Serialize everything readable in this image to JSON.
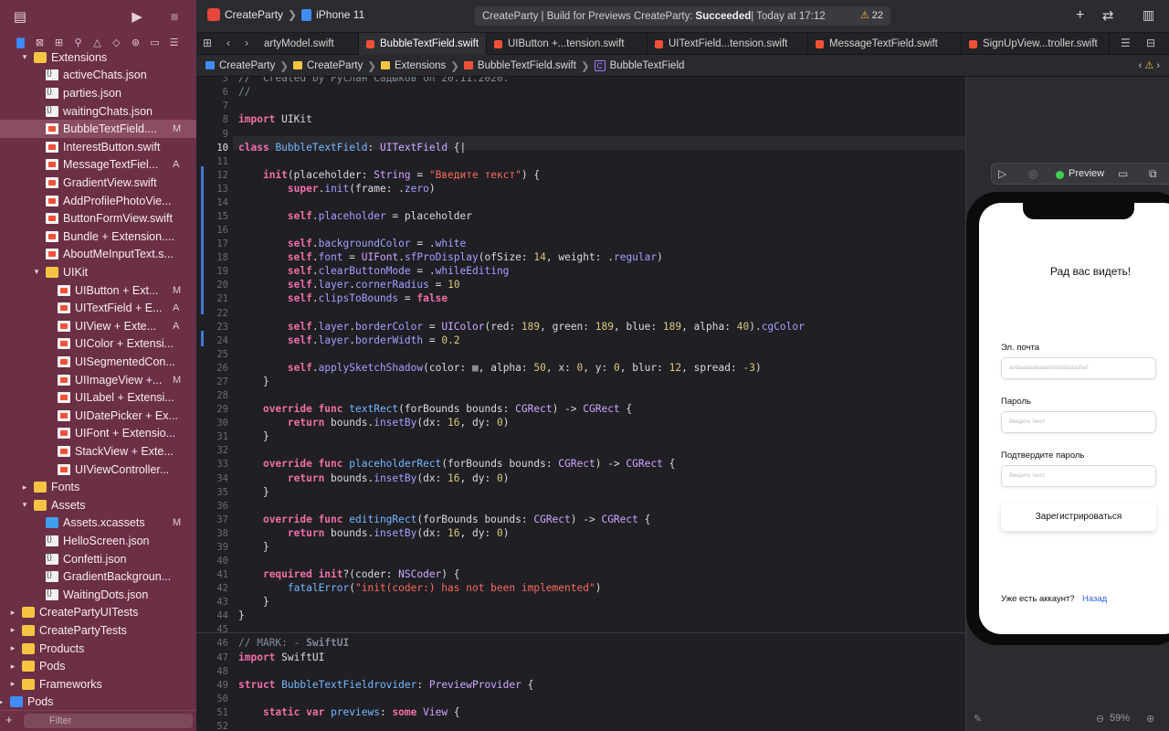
{
  "toolbar": {
    "project": "CreateParty",
    "device": "iPhone 11",
    "status": "CreateParty | Build for Previews CreateParty: ",
    "status_result": "Succeeded",
    "status_time": " | Today at 17:12",
    "warnings": "22"
  },
  "tabs": [
    {
      "label": "artyModel.swift"
    },
    {
      "label": "BubbleTextField.swift"
    },
    {
      "label": "UIButton +...tension.swift"
    },
    {
      "label": "UITextField...tension.swift"
    },
    {
      "label": "MessageTextField.swift"
    },
    {
      "label": "SignUpView...troller.swift"
    }
  ],
  "jumpbar": [
    "CreateParty",
    "CreateParty",
    "Extensions",
    "BubbleTextField.swift",
    "BubbleTextField"
  ],
  "navigator": {
    "filter_placeholder": "Filter",
    "items": [
      {
        "label": "Extensions",
        "type": "folder",
        "depth": 1,
        "open": true
      },
      {
        "label": "activeChats.json",
        "type": "json",
        "depth": 2
      },
      {
        "label": "parties.json",
        "type": "json",
        "depth": 2
      },
      {
        "label": "waitingChats.json",
        "type": "json",
        "depth": 2
      },
      {
        "label": "BubbleTextField....",
        "type": "swift",
        "depth": 2,
        "badge": "M",
        "selected": true
      },
      {
        "label": "InterestButton.swift",
        "type": "swift",
        "depth": 2
      },
      {
        "label": "MessageTextFiel...",
        "type": "swift",
        "depth": 2,
        "badge": "A"
      },
      {
        "label": "GradientView.swift",
        "type": "swift",
        "depth": 2
      },
      {
        "label": "AddProfilePhotoVie...",
        "type": "swift",
        "depth": 2
      },
      {
        "label": "ButtonFormView.swift",
        "type": "swift",
        "depth": 2
      },
      {
        "label": "Bundle + Extension....",
        "type": "swift",
        "depth": 2
      },
      {
        "label": "AboutMeInputText.s...",
        "type": "swift",
        "depth": 2
      },
      {
        "label": "UIKit",
        "type": "folder",
        "depth": 2,
        "open": true
      },
      {
        "label": "UIButton + Ext...",
        "type": "swift",
        "depth": 3,
        "badge": "M"
      },
      {
        "label": "UITextField + E...",
        "type": "swift",
        "depth": 3,
        "badge": "A"
      },
      {
        "label": "UIView + Exte...",
        "type": "swift",
        "depth": 3,
        "badge": "A"
      },
      {
        "label": "UIColor + Extensi...",
        "type": "swift",
        "depth": 3
      },
      {
        "label": "UISegmentedCon...",
        "type": "swift",
        "depth": 3
      },
      {
        "label": "UIImageView +...",
        "type": "swift",
        "depth": 3,
        "badge": "M"
      },
      {
        "label": "UILabel + Extensi...",
        "type": "swift",
        "depth": 3
      },
      {
        "label": "UIDatePicker + Ex...",
        "type": "swift",
        "depth": 3
      },
      {
        "label": "UIFont + Extensio...",
        "type": "swift",
        "depth": 3
      },
      {
        "label": "StackView + Exte...",
        "type": "swift",
        "depth": 3
      },
      {
        "label": "UIViewController...",
        "type": "swift",
        "depth": 3
      },
      {
        "label": "Fonts",
        "type": "folder",
        "depth": 1,
        "open": false
      },
      {
        "label": "Assets",
        "type": "folder",
        "depth": 1,
        "open": true
      },
      {
        "label": "Assets.xcassets",
        "type": "assets",
        "depth": 2,
        "badge": "M"
      },
      {
        "label": "HelloScreen.json",
        "type": "json",
        "depth": 2
      },
      {
        "label": "Confetti.json",
        "type": "json",
        "depth": 2
      },
      {
        "label": "GradientBackgroun...",
        "type": "json",
        "depth": 2
      },
      {
        "label": "WaitingDots.json",
        "type": "json",
        "depth": 2
      },
      {
        "label": "CreatePartyUITests",
        "type": "folder",
        "depth": 0,
        "open": false
      },
      {
        "label": "CreatePartyTests",
        "type": "folder",
        "depth": 0,
        "open": false
      },
      {
        "label": "Products",
        "type": "folder",
        "depth": 0,
        "open": false
      },
      {
        "label": "Pods",
        "type": "folder",
        "depth": 0,
        "open": false
      },
      {
        "label": "Frameworks",
        "type": "folder",
        "depth": 0,
        "open": false
      },
      {
        "label": "Pods",
        "type": "project",
        "depth": -1,
        "open": false
      }
    ]
  },
  "editor": {
    "current_line": 10,
    "lines": [
      {
        "n": 6,
        "html": "<span class=\"cm\">//  Created by Руслан Садыков on 20.11.2020.</span>"
      },
      {
        "n": 7,
        "html": "<span class=\"cm\">//</span>"
      },
      {
        "n": 8,
        "html": ""
      },
      {
        "n": 9,
        "html": "<span class=\"kw\">import</span> UIKit"
      },
      {
        "n": 10,
        "html": ""
      },
      {
        "n": 11,
        "html": "<span class=\"kw\">class</span> <span class=\"fn\">BubbleTextField</span>: <span class=\"ty\">UITextField</span> {|"
      },
      {
        "n": 12,
        "html": ""
      },
      {
        "n": 13,
        "html": "    <span class=\"kw\">init</span>(placeholder: <span class=\"ty\">String</span> = <span class=\"st\">\"Введите текст\"</span>) {"
      },
      {
        "n": 14,
        "html": "        <span class=\"kw\">super</span>.<span class=\"pr\">init</span>(frame: .<span class=\"pr\">zero</span>)"
      },
      {
        "n": 15,
        "html": ""
      },
      {
        "n": 16,
        "html": "        <span class=\"kw\">self</span>.<span class=\"pr\">placeholder</span> = placeholder"
      },
      {
        "n": 17,
        "html": ""
      },
      {
        "n": 18,
        "html": "        <span class=\"kw\">self</span>.<span class=\"pr\">backgroundColor</span> = .<span class=\"pr\">white</span>"
      },
      {
        "n": 19,
        "html": "        <span class=\"kw\">self</span>.<span class=\"pr\">font</span> = <span class=\"ty\">UIFont</span>.<span class=\"pr\">sfProDisplay</span>(ofSize: <span class=\"nu\">14</span>, weight: .<span class=\"pr\">regular</span>)"
      },
      {
        "n": 20,
        "html": "        <span class=\"kw\">self</span>.<span class=\"pr\">clearButtonMode</span> = .<span class=\"pr\">whileEditing</span>"
      },
      {
        "n": 21,
        "html": "        <span class=\"kw\">self</span>.<span class=\"pr\">layer</span>.<span class=\"pr\">cornerRadius</span> = <span class=\"nu\">10</span>"
      },
      {
        "n": 22,
        "html": "        <span class=\"kw\">self</span>.<span class=\"pr\">clipsToBounds</span> = <span class=\"kw\">false</span>"
      },
      {
        "n": 23,
        "html": ""
      },
      {
        "n": 24,
        "html": "        <span class=\"kw\">self</span>.<span class=\"pr\">layer</span>.<span class=\"pr\">borderColor</span> = <span class=\"ty\">UIColor</span>(red: <span class=\"nu\">189</span>, green: <span class=\"nu\">189</span>, blue: <span class=\"nu\">189</span>, alpha: <span class=\"nu\">40</span>).<span class=\"pr\">cgColor</span>"
      },
      {
        "n": 25,
        "html": "        <span class=\"kw\">self</span>.<span class=\"pr\">layer</span>.<span class=\"pr\">borderWidth</span> = <span class=\"nu\">0.2</span>"
      },
      {
        "n": 26,
        "html": ""
      },
      {
        "n": 27,
        "html": "        <span class=\"kw\">self</span>.<span class=\"pr\">applySketchShadow</span>(color: <span class=\"lt\">■</span>, alpha: <span class=\"nu\">50</span>, x: <span class=\"nu\">0</span>, y: <span class=\"nu\">0</span>, blur: <span class=\"nu\">12</span>, spread: <span class=\"nu\">-3</span>)"
      },
      {
        "n": 28,
        "html": "    }"
      },
      {
        "n": 29,
        "html": ""
      },
      {
        "n": 30,
        "html": "    <span class=\"kw\">override func</span> <span class=\"fn\">textRect</span>(forBounds bounds: <span class=\"ty\">CGRect</span>) -> <span class=\"ty\">CGRect</span> {"
      },
      {
        "n": 31,
        "html": "        <span class=\"kw\">return</span> bounds.<span class=\"pr\">insetBy</span>(dx: <span class=\"nu\">16</span>, dy: <span class=\"nu\">0</span>)"
      },
      {
        "n": 32,
        "html": "    }"
      },
      {
        "n": 33,
        "html": ""
      },
      {
        "n": 34,
        "html": "    <span class=\"kw\">override func</span> <span class=\"fn\">placeholderRect</span>(forBounds bounds: <span class=\"ty\">CGRect</span>) -> <span class=\"ty\">CGRect</span> {"
      },
      {
        "n": 35,
        "html": "        <span class=\"kw\">return</span> bounds.<span class=\"pr\">insetBy</span>(dx: <span class=\"nu\">16</span>, dy: <span class=\"nu\">0</span>)"
      },
      {
        "n": 36,
        "html": "    }"
      },
      {
        "n": 37,
        "html": ""
      },
      {
        "n": 38,
        "html": "    <span class=\"kw\">override func</span> <span class=\"fn\">editingRect</span>(forBounds bounds: <span class=\"ty\">CGRect</span>) -> <span class=\"ty\">CGRect</span> {"
      },
      {
        "n": 39,
        "html": "        <span class=\"kw\">return</span> bounds.<span class=\"pr\">insetBy</span>(dx: <span class=\"nu\">16</span>, dy: <span class=\"nu\">0</span>)"
      },
      {
        "n": 40,
        "html": "    }"
      },
      {
        "n": 41,
        "html": ""
      },
      {
        "n": 42,
        "html": "    <span class=\"kw\">required init</span>?(coder: <span class=\"ty\">NSCoder</span>) {"
      },
      {
        "n": 43,
        "html": "        <span class=\"fn\">fatalError</span>(<span class=\"st\">\"init(coder:) has not been implemented\"</span>)"
      },
      {
        "n": 44,
        "html": "    }"
      },
      {
        "n": 45,
        "html": "}"
      },
      {
        "n": 46,
        "html": ""
      },
      {
        "n": 47,
        "html": "<span class=\"cm\">// MARK: - <b>SwiftUI</b></span>"
      },
      {
        "n": 48,
        "html": "<span class=\"kw\">import</span> SwiftUI"
      },
      {
        "n": 49,
        "html": ""
      },
      {
        "n": 50,
        "html": "<span class=\"kw\">struct</span> <span class=\"fn\">BubbleTextFieldrovider</span>: <span class=\"ty\">PreviewProvider</span> {"
      },
      {
        "n": 51,
        "html": ""
      },
      {
        "n": 52,
        "html": "    <span class=\"kw\">static var</span> <span class=\"fn\">previews</span>: <span class=\"kw\">some</span> <span class=\"ty\">View</span> {"
      },
      {
        "n": 53,
        "html": ""
      }
    ]
  },
  "preview": {
    "label": "Preview",
    "zoom": "59%",
    "title": "Рад вас видеть!",
    "email_label": "Эл. почта",
    "email_value": "asdasdasdasdasfasfasfasfasfasf",
    "password_label": "Пароль",
    "password_placeholder": "Введите текст",
    "confirm_label": "Подтвердите пароль",
    "confirm_placeholder": "Введите текст",
    "register_button": "Зарегистрироваться",
    "have_account": "Уже есть аккаунт?",
    "back_link": "Назад",
    "colors": {
      "link": "#2f5fd6",
      "status_ok": "#3ccf4e"
    }
  }
}
